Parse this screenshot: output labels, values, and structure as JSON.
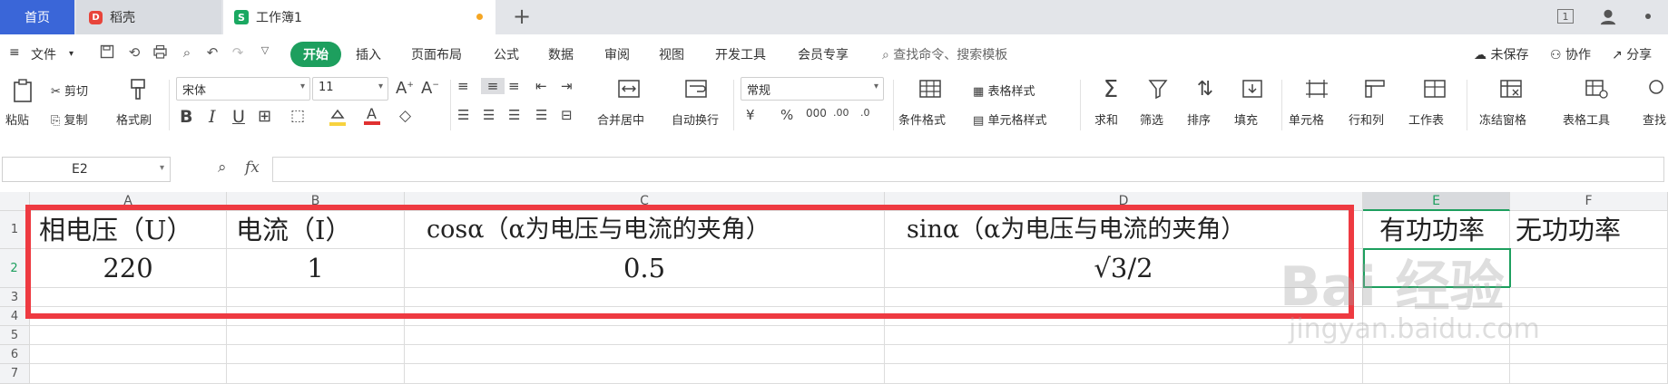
{
  "tabs": {
    "home": "首页",
    "daoke": "稻壳",
    "workbook": "工作簿1",
    "add": "+"
  },
  "window": {
    "page_indicator": "1"
  },
  "menu": {
    "file": "文件",
    "items": [
      "开始",
      "插入",
      "页面布局",
      "公式",
      "数据",
      "审阅",
      "视图",
      "开发工具",
      "会员专享"
    ],
    "search": "查找命令、搜索模板",
    "unsaved": "未保存",
    "collab": "协作",
    "share": "分享"
  },
  "ribbon": {
    "paste": "粘贴",
    "cut": "剪切",
    "copy": "复制",
    "format_painter": "格式刷",
    "font_name": "宋体",
    "font_size": "11",
    "number_format": "常规",
    "merge_center": "合并居中",
    "wrap_text": "自动换行",
    "cond_format": "条件格式",
    "table_style": "表格样式",
    "cell_style": "单元格样式",
    "sum": "求和",
    "filter": "筛选",
    "sort": "排序",
    "fill": "填充",
    "cells": "单元格",
    "rows_cols": "行和列",
    "worksheet": "工作表",
    "freeze": "冻结窗格",
    "table_tools": "表格工具",
    "find": "查找"
  },
  "formula_bar": {
    "cell_ref": "E2",
    "fx": "fx",
    "value": ""
  },
  "grid": {
    "columns": [
      "A",
      "B",
      "C",
      "D",
      "E",
      "F"
    ],
    "rows": [
      "1",
      "2",
      "3",
      "4",
      "5",
      "6",
      "7"
    ],
    "r1": [
      "相电压（U）",
      "电流（I）",
      "cosα（α为电压与电流的夹角）",
      "sinα（α为电压与电流的夹角）",
      "有功功率",
      "无功功率"
    ],
    "r2": [
      "220",
      "1",
      "0.5",
      "√3/2",
      "",
      ""
    ]
  },
  "watermark": {
    "brand": "Bai 经验",
    "url": "jingyan.baidu.com"
  },
  "colors": {
    "accent": "#1d9f5e",
    "tab_home": "#3a66d8",
    "highlight": "#ee3a41"
  }
}
